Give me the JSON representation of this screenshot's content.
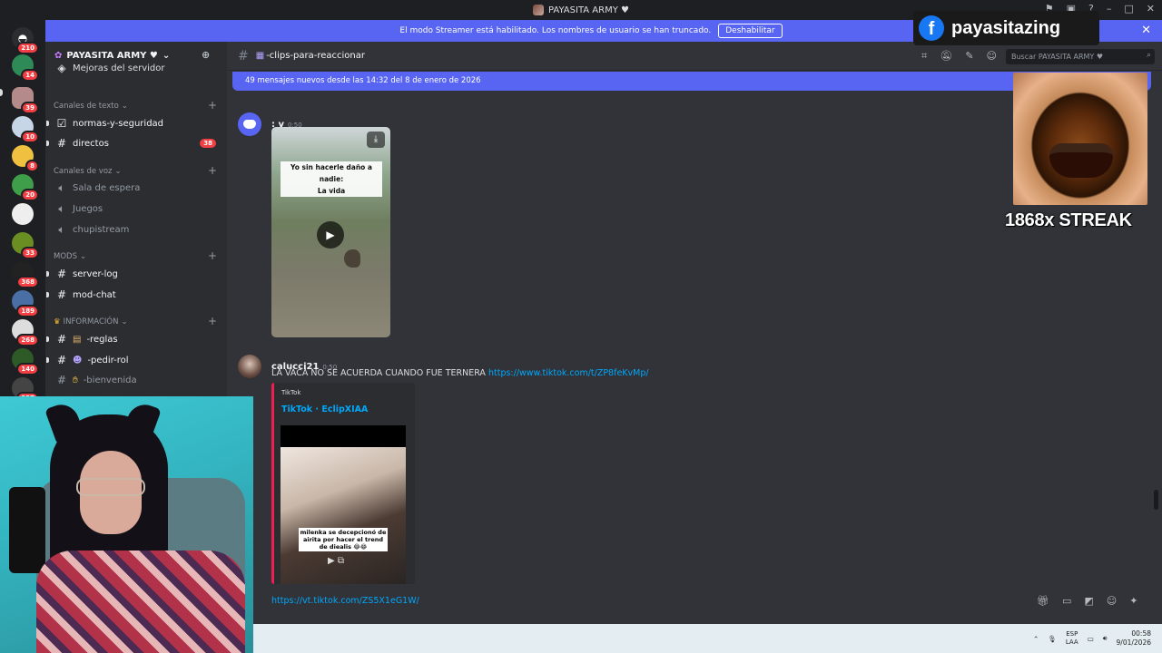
{
  "window": {
    "title": "PAYASITA ARMY ♥"
  },
  "banner": {
    "text": "El modo Streamer está habilitado. Los nombres de usuario se han truncado.",
    "button": "Deshabilitar"
  },
  "servers": [
    {
      "badge": "210",
      "name": "discord-home"
    },
    {
      "badge": "14"
    },
    {
      "badge": "39"
    },
    {
      "badge": "10"
    },
    {
      "badge": "8"
    },
    {
      "badge": "20"
    },
    {
      "badge": ""
    },
    {
      "badge": "33"
    },
    {
      "badge": "368"
    },
    {
      "badge": "189"
    },
    {
      "badge": "268"
    },
    {
      "badge": "140"
    },
    {
      "badge": "337"
    }
  ],
  "guild": {
    "name": "PAYASITA ARMY ♥",
    "partial_item": "Mejoras del servidor"
  },
  "categories": {
    "text": "Canales de texto",
    "voice": "Canales de voz",
    "mods": "MODS",
    "info": "INFORMACIÓN"
  },
  "channels": {
    "normas": "normas-y-seguridad",
    "directos": "directos",
    "directos_badge": "38",
    "sala": "Sala de espera",
    "juegos": "Juegos",
    "chupistream": "chupistream",
    "serverlog": "server-log",
    "modchat": "mod-chat",
    "reglas": "-reglas",
    "pedirrol": "-pedir-rol",
    "bienvenida": "-bienvenida"
  },
  "current_channel": {
    "name": "-clips-para-reaccionar"
  },
  "search": {
    "placeholder": "Buscar PAYASITA ARMY ♥"
  },
  "new_messages": "49 mensajes nuevos desde las 14:32 del 8 de enero de 2026",
  "messages": [
    {
      "author": ": v",
      "time": "0:50",
      "video_caption_1": "Yo sin hacerle daño a nadie:",
      "video_caption_2": "La vida"
    },
    {
      "author": "calucci21",
      "time": "0:50",
      "text": "LA VACA NO SE ACUERDA CUANDO FUE TERNERA",
      "link": "https://www.tiktok.com/t/ZP8feKvMp/",
      "embed": {
        "provider": "TikTok",
        "title": "TikTok · EclipXIAA",
        "thumb_caption": "milenka se decepcionó de airita por hacer el trend de diealis 😂😂"
      }
    }
  ],
  "pending_link": "https://vt.tiktok.com/ZS5X1eG1W/",
  "overlay": {
    "facebook_name": "payasitazing",
    "streak": "1868x STREAK"
  },
  "taskbar": {
    "lang1": "ESP",
    "lang2": "LAA",
    "time": "00:58",
    "date": "9/01/2026"
  },
  "colors": {
    "accent": "#5865f2",
    "badge": "#f23f43",
    "link": "#00a8fc"
  }
}
